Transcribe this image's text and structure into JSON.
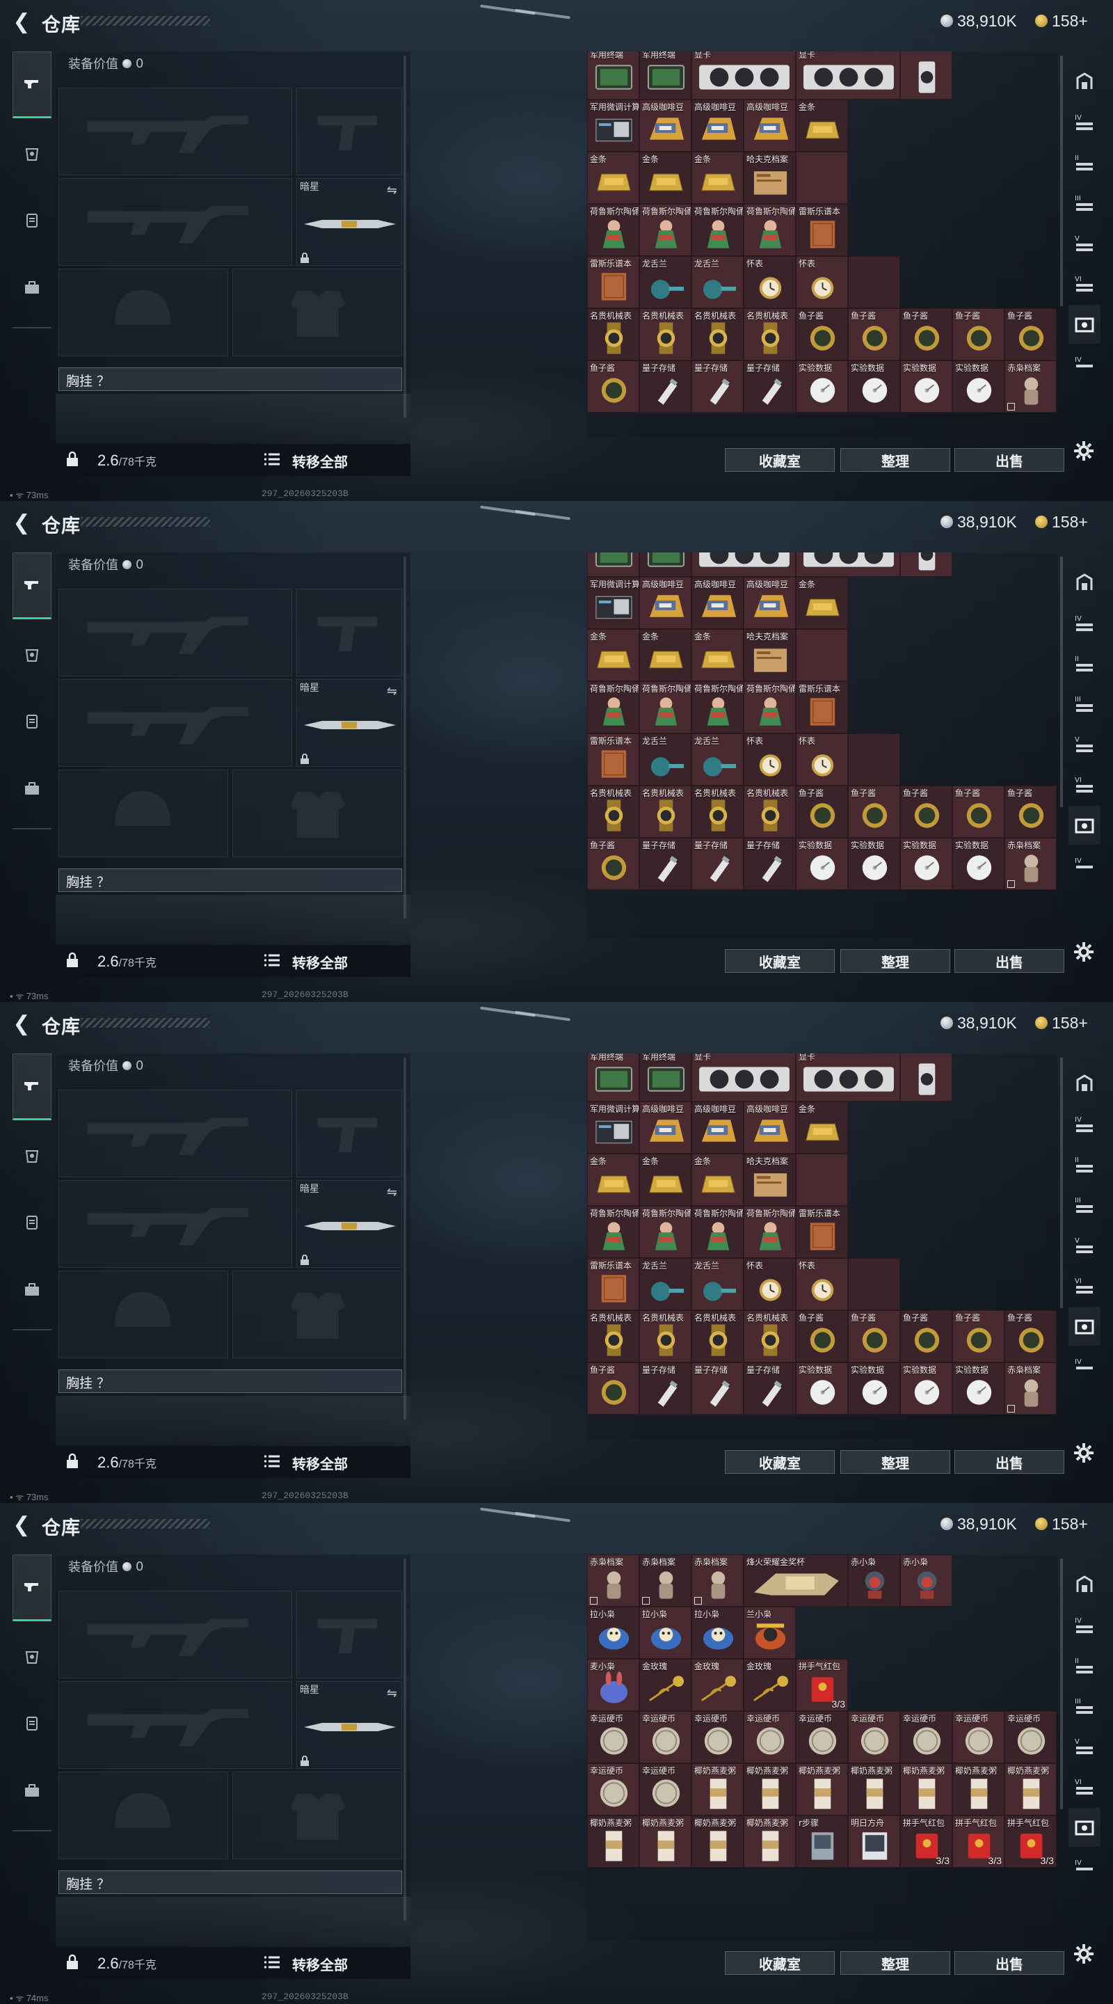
{
  "frames": [
    {
      "grid_offset": 0,
      "ping": "73ms"
    },
    {
      "grid_offset": 0,
      "ping": "73ms"
    },
    {
      "grid_offset": 0,
      "ping": "73ms"
    },
    {
      "grid_offset": 0,
      "ping": "74ms"
    }
  ],
  "header": {
    "title": "仓库",
    "silver_amount": "38,910K",
    "gold_amount": "158+"
  },
  "equipment": {
    "value_label": "装备价值",
    "value": "0",
    "secondary_slot_label": "暗星",
    "chest_rig_label": "胸挂 ？",
    "weight_current": "2.6",
    "weight_max": "/78千克",
    "transfer_all": "转移全部"
  },
  "build_id": "297_20260325203B",
  "actions": {
    "collection": "收藏室",
    "organize": "整理",
    "sell": "出售"
  },
  "icons": {
    "left_nav": [
      "pistol-icon",
      "helmet-icon",
      "backpack-icon",
      "briefcase-icon"
    ],
    "right_tabs": [
      "tab-overview-icon",
      "tab-storage-iv-icon",
      "tab-storage-ii-icon",
      "tab-storage-iii-icon",
      "tab-storage-v-icon",
      "tab-storage-vi-icon",
      "tab-camera-icon",
      "tab-storage-iv2-icon"
    ]
  },
  "grid_a": [
    [
      {
        "l": "军用终端",
        "a": "terminal"
      },
      {
        "l": "军用终端",
        "a": "terminal"
      },
      {
        "l": "显卡",
        "a": "gpu",
        "w": 2
      },
      {
        "l": "显卡",
        "a": "gpu",
        "w": 2
      },
      {
        "l": "",
        "a": "gpu2"
      }
    ],
    [
      {
        "l": "军用微调计算机",
        "a": "computer"
      },
      {
        "l": "高级咖啡豆",
        "a": "coffee"
      },
      {
        "l": "高级咖啡豆",
        "a": "coffee"
      },
      {
        "l": "高级咖啡豆",
        "a": "coffee"
      },
      {
        "l": "金条",
        "a": "goldbar"
      }
    ],
    [
      {
        "l": "金条",
        "a": "goldbar"
      },
      {
        "l": "金条",
        "a": "goldbar"
      },
      {
        "l": "金条",
        "a": "goldbar"
      },
      {
        "l": "哈夫克档案",
        "a": "file"
      },
      {
        "l": "",
        "a": ""
      }
    ],
    [
      {
        "l": "荷鲁斯尔陶俑",
        "a": "figure"
      },
      {
        "l": "荷鲁斯尔陶俑",
        "a": "figure"
      },
      {
        "l": "荷鲁斯尔陶俑",
        "a": "figure"
      },
      {
        "l": "荷鲁斯尔陶俑",
        "a": "figure"
      },
      {
        "l": "雷斯乐谱本",
        "a": "book"
      }
    ],
    [
      {
        "l": "雷斯乐谱本",
        "a": "book"
      },
      {
        "l": "龙舌兰",
        "a": "bottle"
      },
      {
        "l": "龙舌兰",
        "a": "bottle"
      },
      {
        "l": "怀表",
        "a": "pocketwatch"
      },
      {
        "l": "怀表",
        "a": "pocketwatch"
      },
      {
        "l": "",
        "a": ""
      }
    ],
    [
      {
        "l": "名贵机械表",
        "a": "watch"
      },
      {
        "l": "名贵机械表",
        "a": "watch"
      },
      {
        "l": "名贵机械表",
        "a": "watch"
      },
      {
        "l": "名贵机械表",
        "a": "watch"
      },
      {
        "l": "鱼子酱",
        "a": "caviar"
      },
      {
        "l": "鱼子酱",
        "a": "caviar"
      },
      {
        "l": "鱼子酱",
        "a": "caviar"
      },
      {
        "l": "鱼子酱",
        "a": "caviar"
      },
      {
        "l": "鱼子酱",
        "a": "caviar"
      }
    ],
    [
      {
        "l": "鱼子酱",
        "a": "caviar"
      },
      {
        "l": "量子存储",
        "a": "usb"
      },
      {
        "l": "量子存储",
        "a": "usb"
      },
      {
        "l": "量子存储",
        "a": "usb"
      },
      {
        "l": "实验数据",
        "a": "disc"
      },
      {
        "l": "实验数据",
        "a": "disc"
      },
      {
        "l": "实验数据",
        "a": "disc"
      },
      {
        "l": "实验数据",
        "a": "disc"
      },
      {
        "l": "赤枭档案",
        "a": "doll",
        "m": true
      }
    ]
  ],
  "grid_b": [
    [
      {
        "l": "赤枭档案",
        "a": "doll",
        "m": true
      },
      {
        "l": "赤枭档案",
        "a": "doll",
        "m": true
      },
      {
        "l": "赤枭档案",
        "a": "doll",
        "m": true
      },
      {
        "l": "烽火荣耀金奖杯",
        "a": "trophy",
        "w": 2
      },
      {
        "l": "赤小枭",
        "a": "toy"
      },
      {
        "l": "赤小枭",
        "a": "toy"
      }
    ],
    [
      {
        "l": "拉小枭",
        "a": "plush"
      },
      {
        "l": "拉小枭",
        "a": "plush"
      },
      {
        "l": "拉小枭",
        "a": "plush"
      },
      {
        "l": "兰小枭",
        "a": "plush2"
      }
    ],
    [
      {
        "l": "麦小枭",
        "a": "bunny"
      },
      {
        "l": "金玫瑰",
        "a": "rose"
      },
      {
        "l": "金玫瑰",
        "a": "rose"
      },
      {
        "l": "金玫瑰",
        "a": "rose"
      },
      {
        "l": "拼手气红包",
        "a": "redenv",
        "q": "3/3"
      }
    ],
    [
      {
        "l": "幸运硬币",
        "a": "coin"
      },
      {
        "l": "幸运硬币",
        "a": "coin"
      },
      {
        "l": "幸运硬币",
        "a": "coin"
      },
      {
        "l": "幸运硬币",
        "a": "coin"
      },
      {
        "l": "幸运硬币",
        "a": "coin"
      },
      {
        "l": "幸运硬币",
        "a": "coin"
      },
      {
        "l": "幸运硬币",
        "a": "coin"
      },
      {
        "l": "幸运硬币",
        "a": "coin"
      },
      {
        "l": "幸运硬币",
        "a": "coin"
      }
    ],
    [
      {
        "l": "幸运硬币",
        "a": "coin"
      },
      {
        "l": "幸运硬币",
        "a": "coin"
      },
      {
        "l": "椰奶燕麦粥",
        "a": "porridge"
      },
      {
        "l": "椰奶燕麦粥",
        "a": "porridge"
      },
      {
        "l": "椰奶燕麦粥",
        "a": "porridge"
      },
      {
        "l": "椰奶燕麦粥",
        "a": "porridge"
      },
      {
        "l": "椰奶燕麦粥",
        "a": "porridge"
      },
      {
        "l": "椰奶燕麦粥",
        "a": "porridge"
      },
      {
        "l": "椰奶燕麦粥",
        "a": "porridge"
      }
    ],
    [
      {
        "l": "椰奶燕麦粥",
        "a": "porridge"
      },
      {
        "l": "椰奶燕麦粥",
        "a": "porridge"
      },
      {
        "l": "椰奶燕麦粥",
        "a": "porridge"
      },
      {
        "l": "椰奶燕麦粥",
        "a": "porridge"
      },
      {
        "l": "r步骤",
        "a": "card"
      },
      {
        "l": "明日方舟",
        "a": "card2"
      },
      {
        "l": "拼手气红包",
        "a": "redenv",
        "q": "3/3"
      },
      {
        "l": "拼手气红包",
        "a": "redenv",
        "q": "3/3"
      },
      {
        "l": "拼手气红包",
        "a": "redenv",
        "q": "3/3"
      }
    ]
  ]
}
